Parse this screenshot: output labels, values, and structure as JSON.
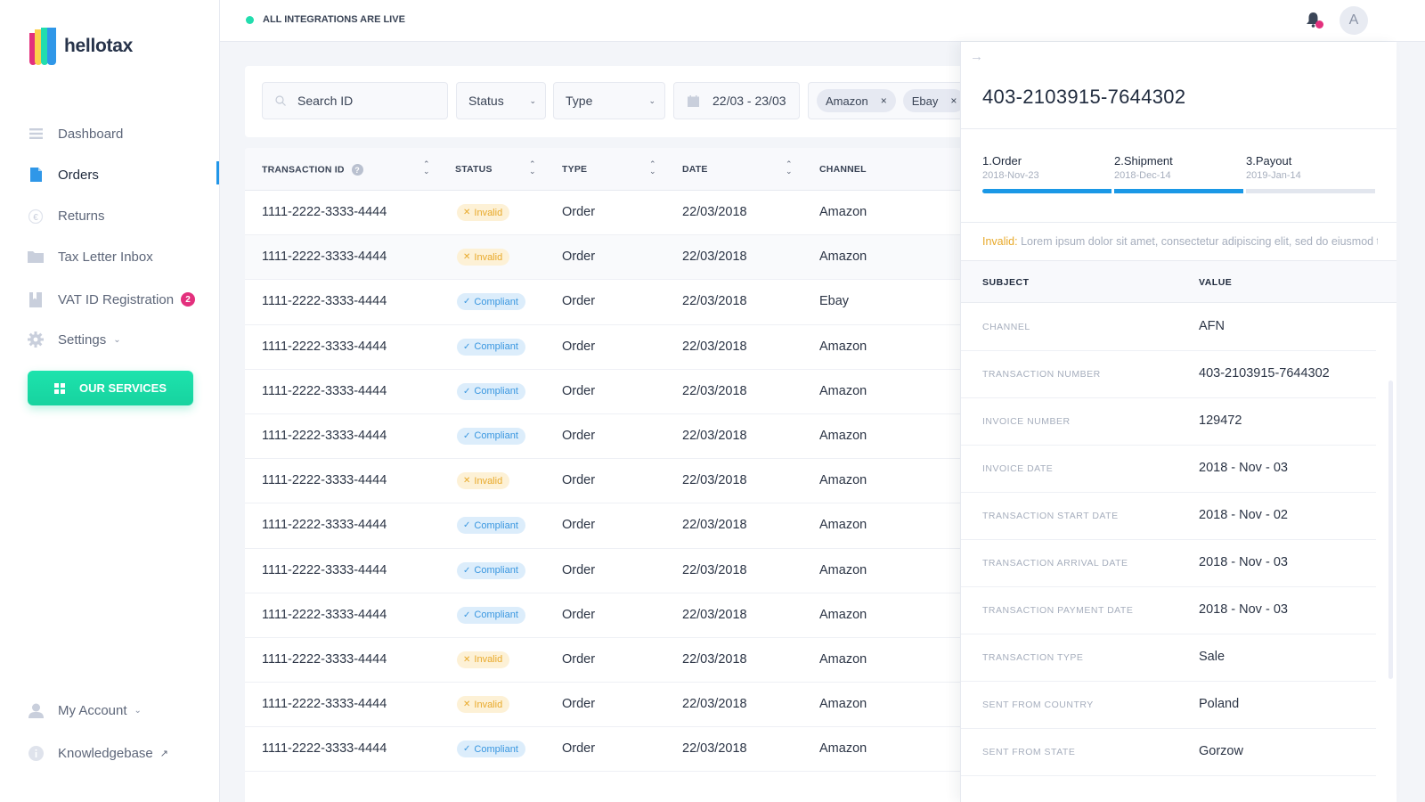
{
  "brand": {
    "name": "hellotax",
    "colors": {
      "pink": "#e3307d",
      "yellow": "#fcd04b",
      "green": "#22ddae",
      "blue": "#2f97e8"
    }
  },
  "sidebar": {
    "items": [
      {
        "label": "Dashboard",
        "icon": "menu-icon"
      },
      {
        "label": "Orders",
        "icon": "document-icon",
        "active": true
      },
      {
        "label": "Returns",
        "icon": "euro-return-icon"
      },
      {
        "label": "Tax Letter Inbox",
        "icon": "folder-icon"
      },
      {
        "label": "VAT ID Registration",
        "icon": "bookmark-icon",
        "badge": "2"
      },
      {
        "label": "Settings",
        "icon": "gear-icon",
        "chevron": "⌄"
      }
    ],
    "services_button": "OUR SERVICES",
    "bottom": [
      {
        "label": "My Account",
        "icon": "user-icon",
        "chevron": "⌄"
      },
      {
        "label": "Knowledgebase",
        "icon": "info-icon",
        "external": "↗"
      }
    ]
  },
  "topbar": {
    "status": "ALL INTEGRATIONS ARE LIVE",
    "avatar_initial": "A"
  },
  "filters": {
    "search_placeholder": "Search ID",
    "status": "Status",
    "type": "Type",
    "date_range": "22/03 - 23/03",
    "channels": [
      "Amazon",
      "Ebay"
    ],
    "chip_remove": "×"
  },
  "table": {
    "headers": {
      "transaction_id": "TRANSACTION ID",
      "status": "STATUS",
      "type": "TYPE",
      "date": "DATE",
      "channel": "CHANNEL"
    },
    "help_glyph": "?",
    "rows": [
      {
        "id": "1111-2222-3333-4444",
        "status": "Invalid",
        "type": "Order",
        "date": "22/03/2018",
        "channel": "Amazon"
      },
      {
        "id": "1111-2222-3333-4444",
        "status": "Invalid",
        "type": "Order",
        "date": "22/03/2018",
        "channel": "Amazon"
      },
      {
        "id": "1111-2222-3333-4444",
        "status": "Compliant",
        "type": "Order",
        "date": "22/03/2018",
        "channel": "Ebay"
      },
      {
        "id": "1111-2222-3333-4444",
        "status": "Compliant",
        "type": "Order",
        "date": "22/03/2018",
        "channel": "Amazon"
      },
      {
        "id": "1111-2222-3333-4444",
        "status": "Compliant",
        "type": "Order",
        "date": "22/03/2018",
        "channel": "Amazon"
      },
      {
        "id": "1111-2222-3333-4444",
        "status": "Compliant",
        "type": "Order",
        "date": "22/03/2018",
        "channel": "Amazon"
      },
      {
        "id": "1111-2222-3333-4444",
        "status": "Invalid",
        "type": "Order",
        "date": "22/03/2018",
        "channel": "Amazon"
      },
      {
        "id": "1111-2222-3333-4444",
        "status": "Compliant",
        "type": "Order",
        "date": "22/03/2018",
        "channel": "Amazon"
      },
      {
        "id": "1111-2222-3333-4444",
        "status": "Compliant",
        "type": "Order",
        "date": "22/03/2018",
        "channel": "Amazon"
      },
      {
        "id": "1111-2222-3333-4444",
        "status": "Compliant",
        "type": "Order",
        "date": "22/03/2018",
        "channel": "Amazon"
      },
      {
        "id": "1111-2222-3333-4444",
        "status": "Invalid",
        "type": "Order",
        "date": "22/03/2018",
        "channel": "Amazon"
      },
      {
        "id": "1111-2222-3333-4444",
        "status": "Invalid",
        "type": "Order",
        "date": "22/03/2018",
        "channel": "Amazon"
      },
      {
        "id": "1111-2222-3333-4444",
        "status": "Compliant",
        "type": "Order",
        "date": "22/03/2018",
        "channel": "Amazon"
      }
    ]
  },
  "detail": {
    "title": "403-2103915-7644302",
    "steps": [
      {
        "label": "1.Order",
        "date": "2018-Nov-23",
        "done": true
      },
      {
        "label": "2.Shipment",
        "date": "2018-Dec-14",
        "done": true
      },
      {
        "label": "3.Payout",
        "date": "2019-Jan-14",
        "done": false
      }
    ],
    "note_label": "Invalid:",
    "note_text": " Lorem ipsum dolor sit amet, consectetur adipiscing elit, sed do eiusmod tempor",
    "headers": {
      "subject": "SUBJECT",
      "value": "VALUE"
    },
    "fields": [
      {
        "key": "CHANNEL",
        "value": "AFN"
      },
      {
        "key": "TRANSACTION NUMBER",
        "value": "403-2103915-7644302"
      },
      {
        "key": "INVOICE NUMBER",
        "value": "129472"
      },
      {
        "key": "INVOICE DATE",
        "value": "2018 - Nov - 03"
      },
      {
        "key": "TRANSACTION START DATE",
        "value": "2018 - Nov - 02"
      },
      {
        "key": "TRANSACTION ARRIVAL DATE",
        "value": "2018 - Nov - 03"
      },
      {
        "key": "TRANSACTION PAYMENT DATE",
        "value": "2018 - Nov - 03"
      },
      {
        "key": "TRANSACTION TYPE",
        "value": "Sale"
      },
      {
        "key": "SENT FROM COUNTRY",
        "value": "Poland"
      },
      {
        "key": "SENT FROM STATE",
        "value": "Gorzow"
      }
    ]
  }
}
